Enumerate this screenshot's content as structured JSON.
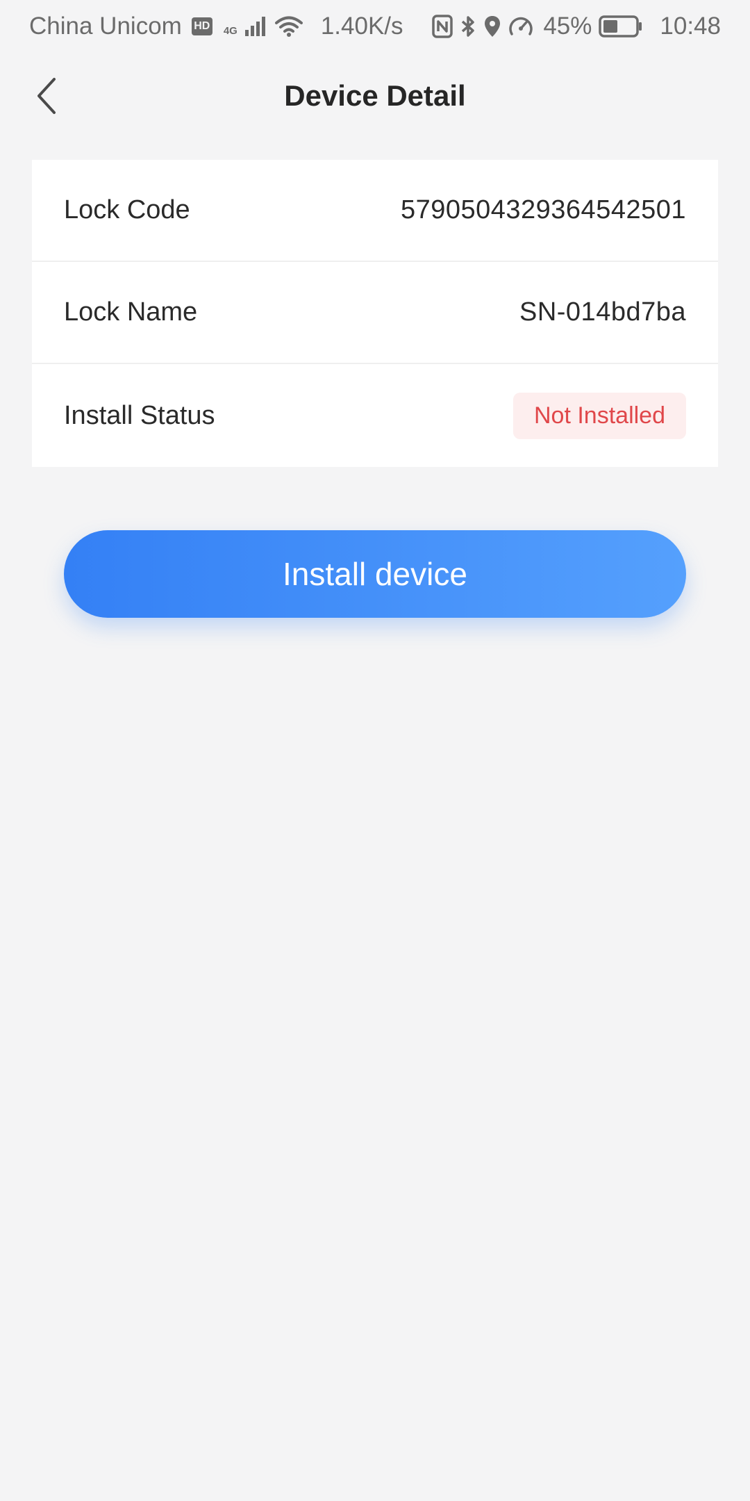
{
  "status_bar": {
    "carrier": "China Unicom",
    "hd_badge": "HD",
    "network_type": "4G",
    "net_speed": "1.40K/s",
    "battery_percent": "45%",
    "battery_level": 0.45,
    "time": "10:48",
    "icons": [
      "hd-icon",
      "signal-icon",
      "wifi-icon",
      "nfc-icon",
      "bluetooth-icon",
      "location-icon",
      "speedometer-icon",
      "battery-icon"
    ]
  },
  "header": {
    "title": "Device Detail",
    "back_icon": "chevron-left-icon"
  },
  "details": {
    "lock_code_label": "Lock Code",
    "lock_code_value": "5790504329364542501",
    "lock_name_label": "Lock Name",
    "lock_name_value": "SN-014bd7ba",
    "install_status_label": "Install Status",
    "install_status_value": "Not Installed"
  },
  "actions": {
    "install_label": "Install device"
  },
  "colors": {
    "background": "#f4f4f5",
    "card": "#ffffff",
    "primary_start": "#3480f5",
    "primary_end": "#55a0fd",
    "danger_text": "#e0474a",
    "danger_bg": "#fdeeee"
  }
}
